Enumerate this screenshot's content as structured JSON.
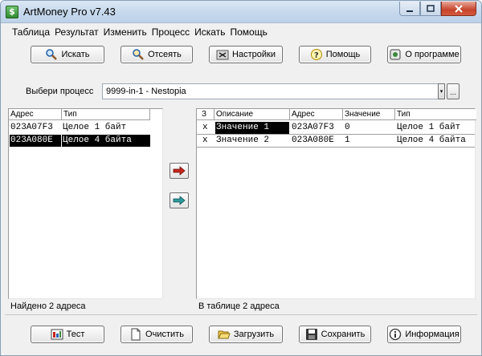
{
  "window": {
    "title": "ArtMoney Pro v7.43"
  },
  "menu": [
    "Таблица",
    "Результат",
    "Изменить",
    "Процесс",
    "Искать",
    "Помощь"
  ],
  "toolbar": {
    "search": "Искать",
    "filter": "Отсеять",
    "settings": "Настройки",
    "help": "Помощь",
    "about": "О программе"
  },
  "process": {
    "label": "Выбери процесс",
    "value": "9999-in-1 - Nestopia",
    "more": "..."
  },
  "results": {
    "columns": [
      "Адрес",
      "Тип"
    ],
    "rows": [
      {
        "address": "023A07F3",
        "type": "Целое 1 байт"
      },
      {
        "address": "023A080E",
        "type": "Целое 4 байта"
      }
    ],
    "status": "Найдено 2 адреса"
  },
  "table": {
    "columns": [
      "З",
      "Описание",
      "Адрес",
      "Значение",
      "Тип"
    ],
    "rows": [
      {
        "freeze": "x",
        "desc": "Значение 1",
        "address": "023A07F3",
        "value": "0",
        "type": "Целое 1 байт"
      },
      {
        "freeze": "x",
        "desc": "Значение 2",
        "address": "023A080E",
        "value": "1",
        "type": "Целое 4 байта"
      }
    ],
    "status": "В таблице 2 адреса"
  },
  "bottom": {
    "test": "Тест",
    "clear": "Очистить",
    "load": "Загрузить",
    "save": "Сохранить",
    "info": "Информация"
  },
  "icons": {
    "search": "magnifier-icon",
    "filter": "magnifier-filter-icon",
    "settings": "settings-icon",
    "help": "question-icon",
    "about": "about-icon",
    "arrow_right": "arrow-right-icon",
    "arrow_back": "arrow-right-teal-icon"
  }
}
